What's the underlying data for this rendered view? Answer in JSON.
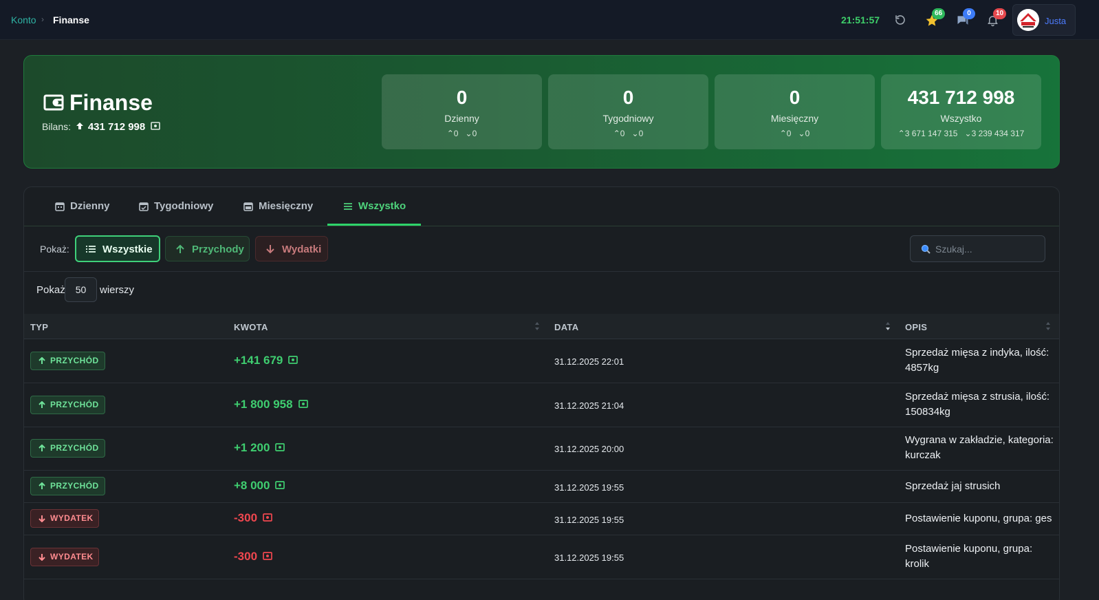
{
  "topbar": {
    "breadcrumb": {
      "parent": "Konto",
      "current": "Finanse"
    },
    "clock": "21:51:57",
    "icons": [
      {
        "name": "refresh-icon"
      },
      {
        "name": "star-icon",
        "badge": "66",
        "badge_color": "#2eb85c"
      },
      {
        "name": "chat-icon",
        "badge": "0",
        "badge_color": "#3d7cf7"
      },
      {
        "name": "bell-icon",
        "badge": "10",
        "badge_color": "#e5484d"
      }
    ],
    "user": {
      "name": "Justa"
    }
  },
  "hero": {
    "title": "Finanse",
    "bilans_label": "Bilans:",
    "bilans_value": "431 712 998",
    "stats": [
      {
        "value": "0",
        "label": "Dzienny",
        "up": "0",
        "down": "0"
      },
      {
        "value": "0",
        "label": "Tygodniowy",
        "up": "0",
        "down": "0"
      },
      {
        "value": "0",
        "label": "Miesięczny",
        "up": "0",
        "down": "0"
      },
      {
        "value": "431 712 998",
        "label": "Wszystko",
        "up": "3 671 147 315",
        "down": "3 239 434 317"
      }
    ]
  },
  "tabs": [
    {
      "label": "Dzienny",
      "active": false
    },
    {
      "label": "Tygodniowy",
      "active": false
    },
    {
      "label": "Miesięczny",
      "active": false
    },
    {
      "label": "Wszystko",
      "active": true
    }
  ],
  "filters": {
    "label": "Pokaż:",
    "buttons": [
      {
        "label": "Wszystkie",
        "active": true
      },
      {
        "label": "Przychody",
        "active": false
      },
      {
        "label": "Wydatki",
        "active": false
      }
    ],
    "search_placeholder": "Szukaj..."
  },
  "rows_control": {
    "pre": "Pokaż",
    "value": "50",
    "post": "wierszy"
  },
  "table": {
    "columns": [
      "TYP",
      "KWOTA",
      "DATA",
      "OPIS"
    ],
    "rows": [
      {
        "type": "PRZYCHÓD",
        "kind": "in",
        "amount": "+141 679",
        "date": "31.12.2025 22:01",
        "desc": "Sprzedaż mięsa z indyka, ilość: 4857kg"
      },
      {
        "type": "PRZYCHÓD",
        "kind": "in",
        "amount": "+1 800 958",
        "date": "31.12.2025 21:04",
        "desc": "Sprzedaż mięsa z strusia, ilość: 150834kg"
      },
      {
        "type": "PRZYCHÓD",
        "kind": "in",
        "amount": "+1 200",
        "date": "31.12.2025 20:00",
        "desc": "Wygrana w zakładzie, kategoria: kurczak"
      },
      {
        "type": "PRZYCHÓD",
        "kind": "in",
        "amount": "+8 000",
        "date": "31.12.2025 19:55",
        "desc": "Sprzedaż jaj strusich"
      },
      {
        "type": "WYDATEK",
        "kind": "out",
        "amount": "-300",
        "date": "31.12.2025 19:55",
        "desc": "Postawienie kuponu, grupa: ges"
      },
      {
        "type": "WYDATEK",
        "kind": "out",
        "amount": "-300",
        "date": "31.12.2025 19:55",
        "desc": "Postawienie kuponu, grupa: krolik"
      }
    ]
  },
  "colors": {
    "income": "#3fce70",
    "expense": "#f0474f",
    "accent": "#2ed36a"
  }
}
